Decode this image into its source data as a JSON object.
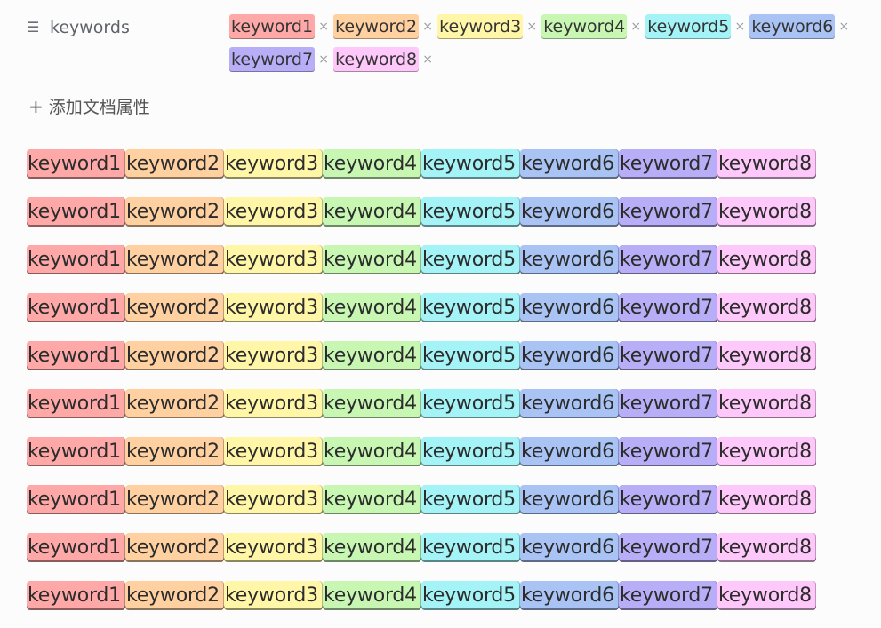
{
  "property": {
    "icon": "list-icon",
    "key": "keywords",
    "tags": [
      {
        "label": "keyword1",
        "color": "#ffa8a8"
      },
      {
        "label": "keyword2",
        "color": "#ffd0a0"
      },
      {
        "label": "keyword3",
        "color": "#fff6a8"
      },
      {
        "label": "keyword4",
        "color": "#c7f7b3"
      },
      {
        "label": "keyword5",
        "color": "#a3f3f7"
      },
      {
        "label": "keyword6",
        "color": "#a9c3f5"
      },
      {
        "label": "keyword7",
        "color": "#b8aef7"
      },
      {
        "label": "keyword8",
        "color": "#ffc8fa"
      }
    ],
    "remove_glyph": "×"
  },
  "add_property": {
    "icon": "plus-icon",
    "icon_glyph": "+",
    "label": "添加文档属性"
  },
  "grid": {
    "row_count": 10,
    "items": [
      {
        "label": "keyword1",
        "color": "#ffa8a8"
      },
      {
        "label": "keyword2",
        "color": "#ffd0a0"
      },
      {
        "label": "keyword3",
        "color": "#fff6a8"
      },
      {
        "label": "keyword4",
        "color": "#c7f7b3"
      },
      {
        "label": "keyword5",
        "color": "#a3f3f7"
      },
      {
        "label": "keyword6",
        "color": "#a9c3f5"
      },
      {
        "label": "keyword7",
        "color": "#b8aef7"
      },
      {
        "label": "keyword8",
        "color": "#ffc8fa"
      }
    ]
  }
}
